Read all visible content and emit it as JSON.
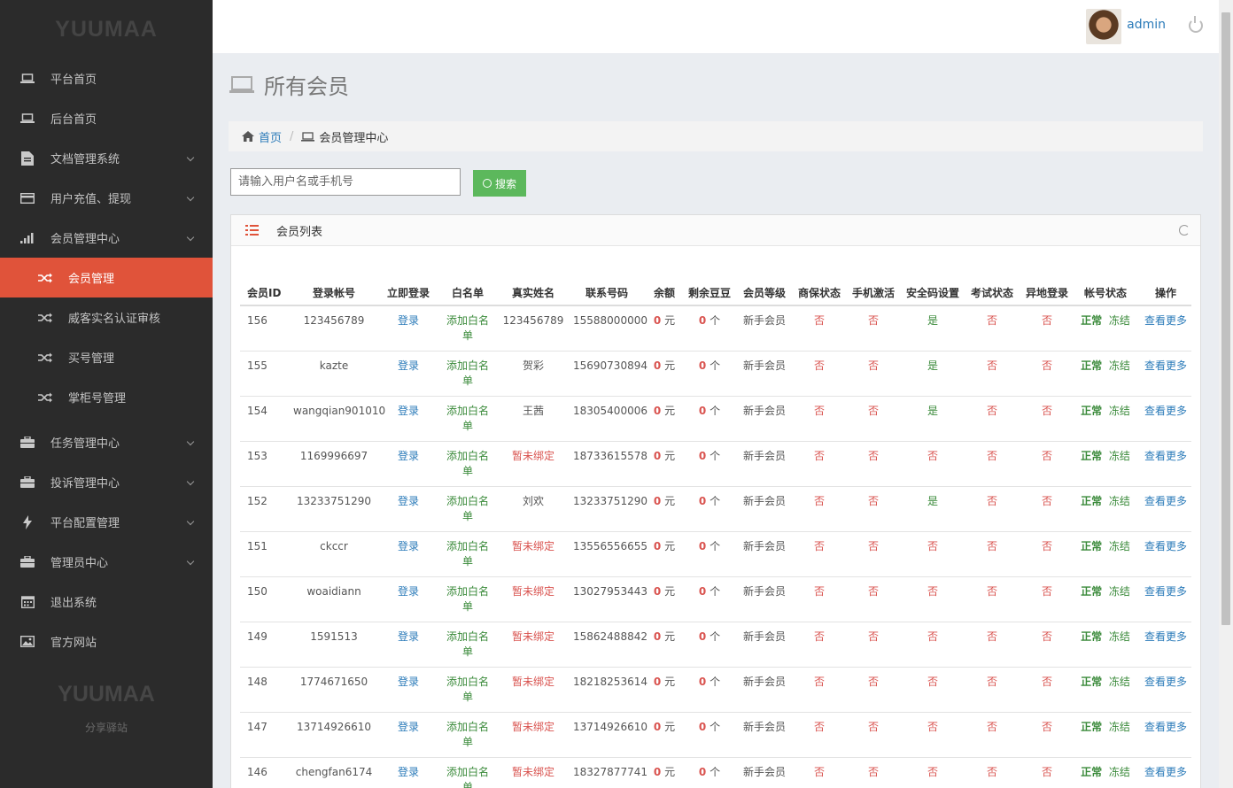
{
  "sidebar": {
    "logo": "YUUMAA",
    "items": [
      {
        "label": "平台首页",
        "icon": "laptop-icon",
        "caret": false
      },
      {
        "label": "后台首页",
        "icon": "laptop-icon",
        "caret": false
      },
      {
        "label": "文档管理系统",
        "icon": "document-icon",
        "caret": true
      },
      {
        "label": "用户充值、提现",
        "icon": "card-icon",
        "caret": true
      },
      {
        "label": "会员管理中心",
        "icon": "bar-chart-icon",
        "caret": true
      }
    ],
    "sub_items": [
      {
        "label": "会员管理",
        "active": true
      },
      {
        "label": "威客实名认证审核",
        "active": false
      },
      {
        "label": "买号管理",
        "active": false
      },
      {
        "label": "掌柜号管理",
        "active": false
      }
    ],
    "items2": [
      {
        "label": "任务管理中心",
        "icon": "briefcase-icon",
        "caret": true
      },
      {
        "label": "投诉管理中心",
        "icon": "briefcase-icon",
        "caret": true
      },
      {
        "label": "平台配置管理",
        "icon": "bolt-icon",
        "caret": true
      },
      {
        "label": "管理员中心",
        "icon": "briefcase-icon",
        "caret": true
      },
      {
        "label": "退出系统",
        "icon": "calendar-icon",
        "caret": false
      },
      {
        "label": "官方网站",
        "icon": "image-icon",
        "caret": false
      }
    ],
    "footer_logo": "YUUMAA",
    "footer_sub": "分享驿站"
  },
  "topbar": {
    "username": "admin"
  },
  "page": {
    "title": "所有会员",
    "breadcrumb_home": "首页",
    "breadcrumb_current": "会员管理中心",
    "search_placeholder": "请输入用户名或手机号",
    "search_label": "搜索",
    "panel_title": "会员列表"
  },
  "table": {
    "headers": [
      "会员ID",
      "登录帐号",
      "立即登录",
      "白名单",
      "真实姓名",
      "联系号码",
      "余额",
      "剩余豆豆",
      "会员等级",
      "商保状态",
      "手机激活",
      "安全码设置",
      "考试状态",
      "异地登录",
      "帐号状态",
      "操作"
    ],
    "common": {
      "login": "登录",
      "whitelist": "添加白名单",
      "balance": "0",
      "balance_unit": "元",
      "beans": "0",
      "beans_unit": "个",
      "level": "新手会员",
      "status": "正常",
      "freeze": "冻结",
      "more": "查看更多"
    },
    "rows": [
      {
        "id": "156",
        "account": "123456789",
        "name": "123456789",
        "phone": "15588000000",
        "insure": "否",
        "mobile": "否",
        "safe": "是",
        "exam": "否",
        "remote": "否"
      },
      {
        "id": "155",
        "account": "kazte",
        "name": "贺彩",
        "phone": "15690730894",
        "insure": "否",
        "mobile": "否",
        "safe": "是",
        "exam": "否",
        "remote": "否"
      },
      {
        "id": "154",
        "account": "wangqian901010",
        "name": "王茜",
        "phone": "18305400006",
        "insure": "否",
        "mobile": "否",
        "safe": "是",
        "exam": "否",
        "remote": "否"
      },
      {
        "id": "153",
        "account": "1169996697",
        "name": "暂未绑定",
        "phone": "18733615578",
        "insure": "否",
        "mobile": "否",
        "safe": "否",
        "exam": "否",
        "remote": "否"
      },
      {
        "id": "152",
        "account": "13233751290",
        "name": "刘欢",
        "phone": "13233751290",
        "insure": "否",
        "mobile": "否",
        "safe": "是",
        "exam": "否",
        "remote": "否"
      },
      {
        "id": "151",
        "account": "ckccr",
        "name": "暂未绑定",
        "phone": "13556556655",
        "insure": "否",
        "mobile": "否",
        "safe": "否",
        "exam": "否",
        "remote": "否"
      },
      {
        "id": "150",
        "account": "woaidiann",
        "name": "暂未绑定",
        "phone": "13027953443",
        "insure": "否",
        "mobile": "否",
        "safe": "否",
        "exam": "否",
        "remote": "否"
      },
      {
        "id": "149",
        "account": "1591513",
        "name": "暂未绑定",
        "phone": "15862488842",
        "insure": "否",
        "mobile": "否",
        "safe": "否",
        "exam": "否",
        "remote": "否"
      },
      {
        "id": "148",
        "account": "1774671650",
        "name": "暂未绑定",
        "phone": "18218253614",
        "insure": "否",
        "mobile": "否",
        "safe": "否",
        "exam": "否",
        "remote": "否"
      },
      {
        "id": "147",
        "account": "13714926610",
        "name": "暂未绑定",
        "phone": "13714926610",
        "insure": "否",
        "mobile": "否",
        "safe": "否",
        "exam": "否",
        "remote": "否"
      },
      {
        "id": "146",
        "account": "chengfan6174",
        "name": "暂未绑定",
        "phone": "18327877741",
        "insure": "否",
        "mobile": "否",
        "safe": "否",
        "exam": "否",
        "remote": "否"
      }
    ]
  }
}
